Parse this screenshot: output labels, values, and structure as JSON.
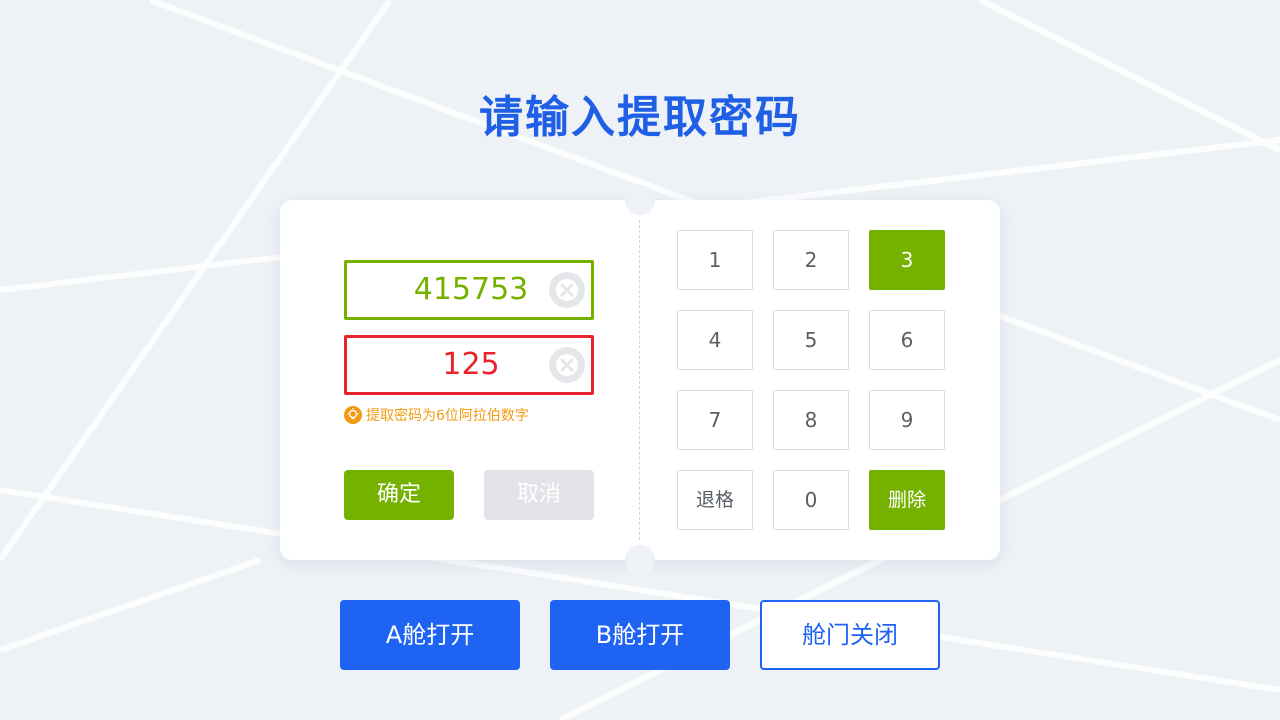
{
  "page": {
    "title": "请输入提取密码"
  },
  "form": {
    "code_value": "415753",
    "password_value": "125",
    "hint": "提取密码为6位阿拉伯数字",
    "confirm_label": "确定",
    "cancel_label": "取消",
    "icons": {
      "clear": "close-icon",
      "hint": "lightbulb-icon"
    }
  },
  "keypad": {
    "keys": [
      "1",
      "2",
      "3",
      "4",
      "5",
      "6",
      "7",
      "8",
      "9",
      "退格",
      "0",
      "删除"
    ],
    "active_keys": [
      "3",
      "删除"
    ]
  },
  "actions": {
    "open_a": "A舱打开",
    "open_b": "B舱打开",
    "close_door": "舱门关闭"
  },
  "colors": {
    "title": "#1e5fe6",
    "success": "#75b200",
    "error": "#e8232b",
    "hint": "#f29a10",
    "primary": "#1f63f5",
    "background": "#eef2f6"
  }
}
